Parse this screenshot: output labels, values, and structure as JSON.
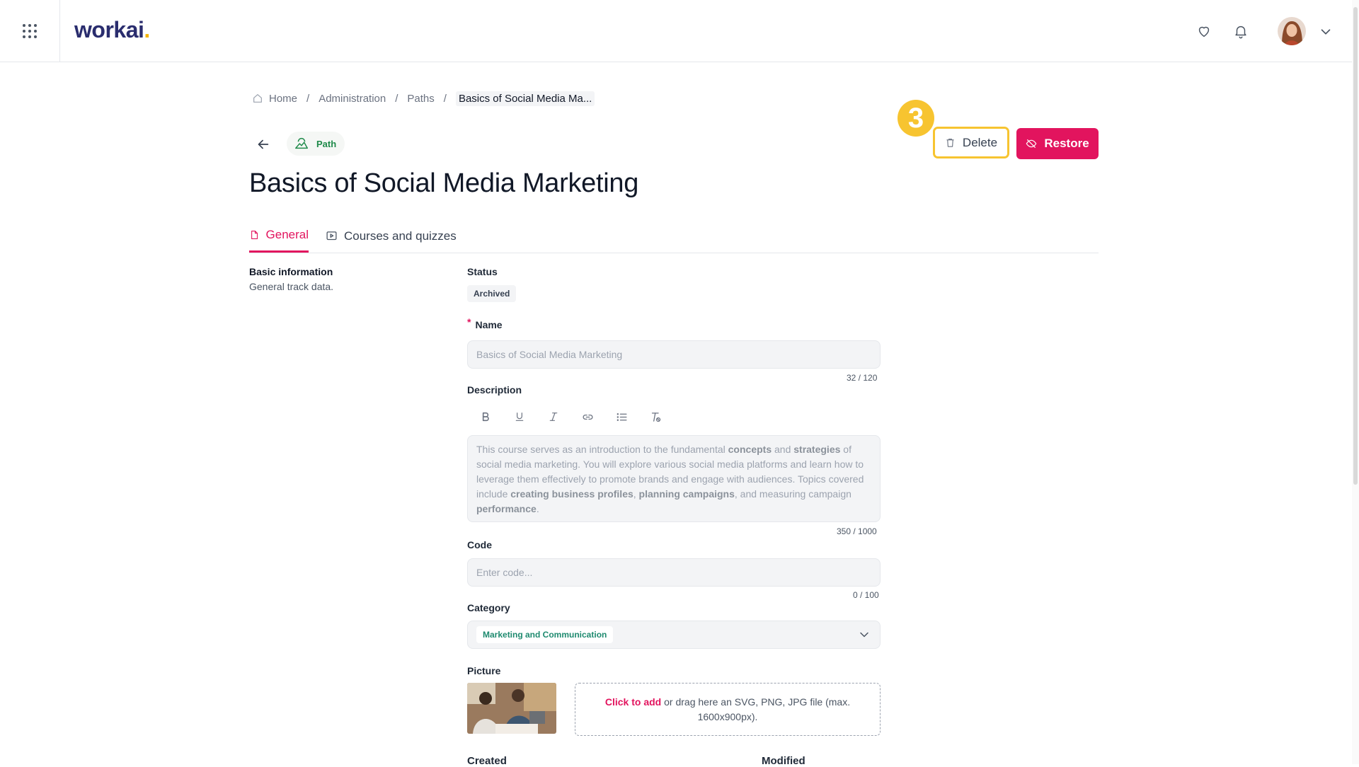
{
  "app": {
    "logo_text": "workai",
    "logo_dot": "."
  },
  "topbar": {
    "icons": [
      "apps-grid-icon",
      "heart-icon",
      "bell-icon",
      "chevron-down-icon"
    ]
  },
  "breadcrumb": {
    "home": "Home",
    "items": [
      "Administration",
      "Paths"
    ],
    "current": "Basics of Social Media Ma...",
    "separator": "/"
  },
  "header": {
    "tag_label": "Path",
    "title": "Basics of Social Media Marketing",
    "step_number": "3",
    "delete_label": "Delete",
    "restore_label": "Restore"
  },
  "tabs": [
    {
      "label": "General",
      "active": true
    },
    {
      "label": "Courses and quizzes",
      "active": false
    }
  ],
  "section": {
    "title": "Basic information",
    "subtitle": "General track data."
  },
  "form": {
    "status_label": "Status",
    "status_value": "Archived",
    "required_marker": "*",
    "name_label": "Name",
    "name_value": "Basics of Social Media Marketing",
    "name_counter": "32 / 120",
    "description_label": "Description",
    "description_parts": [
      {
        "text": "This course serves as an introduction to the fundamental ",
        "bold": false
      },
      {
        "text": "concepts",
        "bold": true
      },
      {
        "text": " and ",
        "bold": false
      },
      {
        "text": "strategies",
        "bold": true
      },
      {
        "text": " of social media marketing. You will explore various social media platforms and learn how to leverage them effectively to promote brands and engage with audiences. Topics covered include ",
        "bold": false
      },
      {
        "text": "creating business profiles",
        "bold": true
      },
      {
        "text": ", ",
        "bold": false
      },
      {
        "text": "planning campaigns",
        "bold": true
      },
      {
        "text": ", and measuring campaign ",
        "bold": false
      },
      {
        "text": "performance",
        "bold": true
      },
      {
        "text": ".",
        "bold": false
      }
    ],
    "description_counter": "350 / 1000",
    "code_label": "Code",
    "code_placeholder": "Enter code...",
    "code_counter": "0 / 100",
    "category_label": "Category",
    "category_value": "Marketing and Communication",
    "picture_label": "Picture",
    "dropzone_link": "Click to add",
    "dropzone_text": " or drag here an SVG, PNG, JPG file (max. 1600x900px).",
    "created_label": "Created",
    "modified_label": "Modified"
  },
  "colors": {
    "accent": "#e2145e",
    "highlight": "#f7c430",
    "tag_green": "#1f8a4a",
    "logo": "#2a2d6e"
  }
}
